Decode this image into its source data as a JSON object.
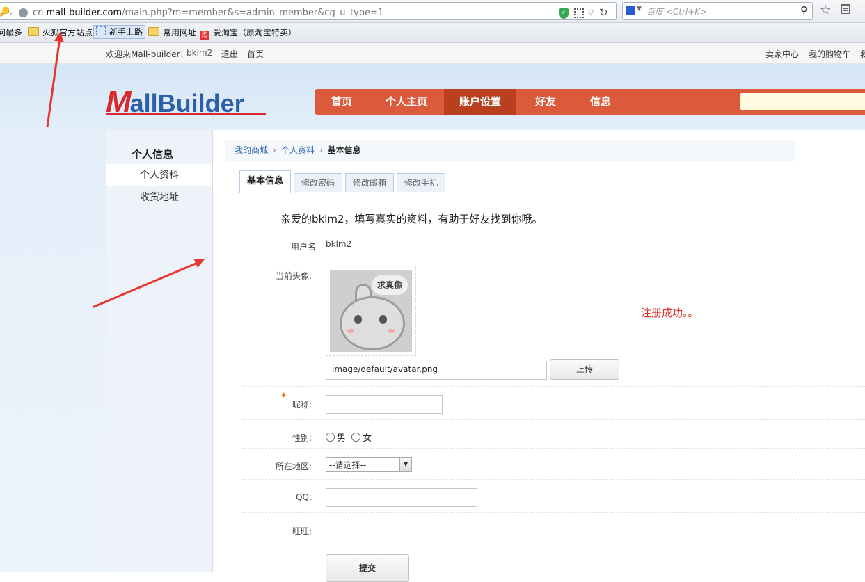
{
  "browser": {
    "url_host_prefix": "cn.",
    "url_host": "mall-builder.com",
    "url_path": "/main.php?m=member&s=admin_member&cg_u_type=1",
    "search_placeholder": "百度 <Ctrl+K>",
    "bookmarks": [
      "问最多",
      "火狐官方站点",
      "新手上路",
      "常用网址",
      "爱淘宝（原淘宝特卖）"
    ]
  },
  "topbar": {
    "welcome": "欢迎来Mall-builder！",
    "username": "bklm2",
    "logout": "退出",
    "home": "首页",
    "seller_center": "卖家中心",
    "cart": "我的购物车",
    "more": "我"
  },
  "logo": {
    "first": "M",
    "rest": "allBuilder"
  },
  "nav": {
    "items": [
      "首页",
      "个人主页",
      "账户设置",
      "好友",
      "信息"
    ],
    "active": "账户设置"
  },
  "sidebar": {
    "title": "个人信息",
    "items": [
      "个人资料",
      "收货地址"
    ]
  },
  "breadcrumb": [
    "我的商城",
    "个人资料",
    "基本信息"
  ],
  "tabs": [
    "基本信息",
    "修改密码",
    "修改邮箱",
    "修改手机"
  ],
  "form": {
    "intro": "亲爱的bklm2，填写真实的资料，有助于好友找到你哦。",
    "username_label": "用户名",
    "username_value": "bklm2",
    "avatar_label": "当前头像:",
    "avatar_caption": "求真像",
    "avatar_path": "image/default/avatar.png",
    "upload_label": "上传",
    "nickname_label": "昵称:",
    "nickname_value": "",
    "gender_label": "性别:",
    "gender_options": [
      "男",
      "女"
    ],
    "region_label": "所在地区:",
    "region_selected": "--请选择--",
    "qq_label": "QQ:",
    "qq_value": "",
    "wangwang_label": "旺旺:",
    "wangwang_value": "",
    "submit_label": "提交",
    "success_message": "注册成功。。"
  },
  "colors": {
    "nav_bg": "#dc5a3c",
    "nav_active": "#b8401f",
    "logo_red": "#d72b2b",
    "logo_blue": "#2b5fa7",
    "success": "#d6332a",
    "annotation_arrow": "#e8352e"
  }
}
